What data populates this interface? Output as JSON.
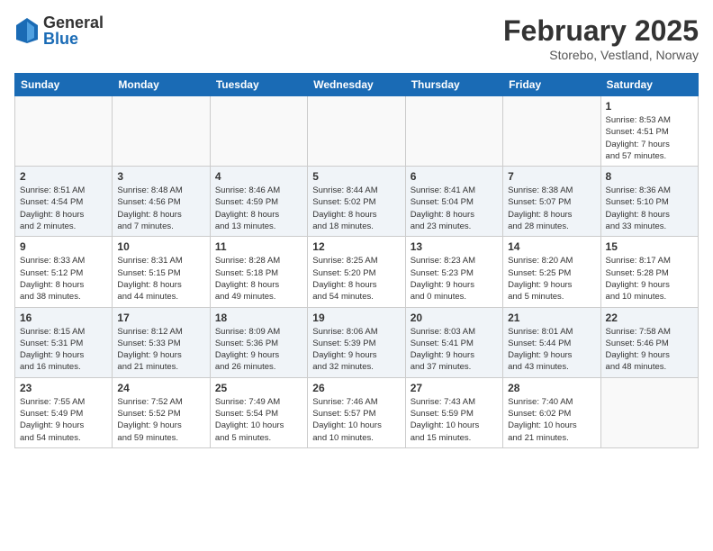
{
  "header": {
    "logo_general": "General",
    "logo_blue": "Blue",
    "month_title": "February 2025",
    "subtitle": "Storebo, Vestland, Norway"
  },
  "weekdays": [
    "Sunday",
    "Monday",
    "Tuesday",
    "Wednesday",
    "Thursday",
    "Friday",
    "Saturday"
  ],
  "weeks": [
    [
      {
        "day": "",
        "info": ""
      },
      {
        "day": "",
        "info": ""
      },
      {
        "day": "",
        "info": ""
      },
      {
        "day": "",
        "info": ""
      },
      {
        "day": "",
        "info": ""
      },
      {
        "day": "",
        "info": ""
      },
      {
        "day": "1",
        "info": "Sunrise: 8:53 AM\nSunset: 4:51 PM\nDaylight: 7 hours\nand 57 minutes."
      }
    ],
    [
      {
        "day": "2",
        "info": "Sunrise: 8:51 AM\nSunset: 4:54 PM\nDaylight: 8 hours\nand 2 minutes."
      },
      {
        "day": "3",
        "info": "Sunrise: 8:48 AM\nSunset: 4:56 PM\nDaylight: 8 hours\nand 7 minutes."
      },
      {
        "day": "4",
        "info": "Sunrise: 8:46 AM\nSunset: 4:59 PM\nDaylight: 8 hours\nand 13 minutes."
      },
      {
        "day": "5",
        "info": "Sunrise: 8:44 AM\nSunset: 5:02 PM\nDaylight: 8 hours\nand 18 minutes."
      },
      {
        "day": "6",
        "info": "Sunrise: 8:41 AM\nSunset: 5:04 PM\nDaylight: 8 hours\nand 23 minutes."
      },
      {
        "day": "7",
        "info": "Sunrise: 8:38 AM\nSunset: 5:07 PM\nDaylight: 8 hours\nand 28 minutes."
      },
      {
        "day": "8",
        "info": "Sunrise: 8:36 AM\nSunset: 5:10 PM\nDaylight: 8 hours\nand 33 minutes."
      }
    ],
    [
      {
        "day": "9",
        "info": "Sunrise: 8:33 AM\nSunset: 5:12 PM\nDaylight: 8 hours\nand 38 minutes."
      },
      {
        "day": "10",
        "info": "Sunrise: 8:31 AM\nSunset: 5:15 PM\nDaylight: 8 hours\nand 44 minutes."
      },
      {
        "day": "11",
        "info": "Sunrise: 8:28 AM\nSunset: 5:18 PM\nDaylight: 8 hours\nand 49 minutes."
      },
      {
        "day": "12",
        "info": "Sunrise: 8:25 AM\nSunset: 5:20 PM\nDaylight: 8 hours\nand 54 minutes."
      },
      {
        "day": "13",
        "info": "Sunrise: 8:23 AM\nSunset: 5:23 PM\nDaylight: 9 hours\nand 0 minutes."
      },
      {
        "day": "14",
        "info": "Sunrise: 8:20 AM\nSunset: 5:25 PM\nDaylight: 9 hours\nand 5 minutes."
      },
      {
        "day": "15",
        "info": "Sunrise: 8:17 AM\nSunset: 5:28 PM\nDaylight: 9 hours\nand 10 minutes."
      }
    ],
    [
      {
        "day": "16",
        "info": "Sunrise: 8:15 AM\nSunset: 5:31 PM\nDaylight: 9 hours\nand 16 minutes."
      },
      {
        "day": "17",
        "info": "Sunrise: 8:12 AM\nSunset: 5:33 PM\nDaylight: 9 hours\nand 21 minutes."
      },
      {
        "day": "18",
        "info": "Sunrise: 8:09 AM\nSunset: 5:36 PM\nDaylight: 9 hours\nand 26 minutes."
      },
      {
        "day": "19",
        "info": "Sunrise: 8:06 AM\nSunset: 5:39 PM\nDaylight: 9 hours\nand 32 minutes."
      },
      {
        "day": "20",
        "info": "Sunrise: 8:03 AM\nSunset: 5:41 PM\nDaylight: 9 hours\nand 37 minutes."
      },
      {
        "day": "21",
        "info": "Sunrise: 8:01 AM\nSunset: 5:44 PM\nDaylight: 9 hours\nand 43 minutes."
      },
      {
        "day": "22",
        "info": "Sunrise: 7:58 AM\nSunset: 5:46 PM\nDaylight: 9 hours\nand 48 minutes."
      }
    ],
    [
      {
        "day": "23",
        "info": "Sunrise: 7:55 AM\nSunset: 5:49 PM\nDaylight: 9 hours\nand 54 minutes."
      },
      {
        "day": "24",
        "info": "Sunrise: 7:52 AM\nSunset: 5:52 PM\nDaylight: 9 hours\nand 59 minutes."
      },
      {
        "day": "25",
        "info": "Sunrise: 7:49 AM\nSunset: 5:54 PM\nDaylight: 10 hours\nand 5 minutes."
      },
      {
        "day": "26",
        "info": "Sunrise: 7:46 AM\nSunset: 5:57 PM\nDaylight: 10 hours\nand 10 minutes."
      },
      {
        "day": "27",
        "info": "Sunrise: 7:43 AM\nSunset: 5:59 PM\nDaylight: 10 hours\nand 15 minutes."
      },
      {
        "day": "28",
        "info": "Sunrise: 7:40 AM\nSunset: 6:02 PM\nDaylight: 10 hours\nand 21 minutes."
      },
      {
        "day": "",
        "info": ""
      }
    ]
  ]
}
